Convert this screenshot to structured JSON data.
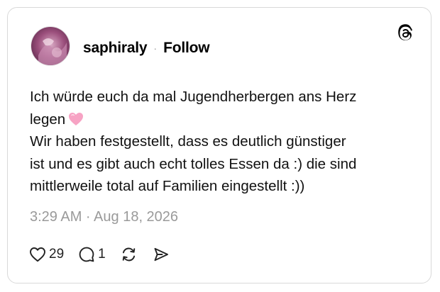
{
  "post": {
    "author": {
      "username": "saphiraly",
      "separator": "·",
      "follow_label": "Follow"
    },
    "text_lines": [
      "Ich würde euch da mal Jugendherbergen ans Herz",
      "legen",
      "Wir haben festgestellt, dass es deutlich günstiger",
      "ist und es gibt auch echt tolles Essen da :) die sind",
      "mittlerweile total auf Familien eingestellt :))"
    ],
    "emoji": "pink-heart",
    "timestamp": "3:29 AM · Aug 18, 2026",
    "stats": {
      "likes": "29",
      "replies": "1"
    },
    "icons": {
      "logo": "threads-logo-icon",
      "like": "heart-icon",
      "reply": "comment-icon",
      "repost": "repost-icon",
      "share": "share-icon"
    },
    "colors": {
      "emoji_heart": "#f7a3c4",
      "muted_text": "#9a9a9a",
      "card_border": "#d9d9d9"
    }
  }
}
